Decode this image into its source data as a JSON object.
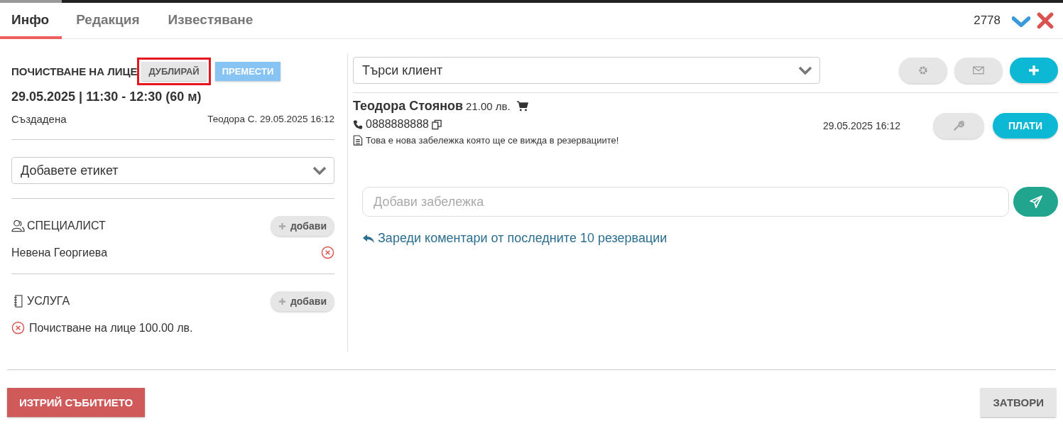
{
  "tabs": [
    {
      "label": "Инфо",
      "selected": true
    },
    {
      "label": "Редакция",
      "selected": false
    },
    {
      "label": "Известяване",
      "selected": false
    }
  ],
  "header": {
    "record_id": "2778"
  },
  "event": {
    "title": "ПОЧИСТВАНЕ НА ЛИЦЕ",
    "actions": [
      {
        "kind": "duplicate",
        "label": "ДУБЛИРАЙ",
        "highlighted": true
      },
      {
        "kind": "move",
        "label": "ПРЕМЕСТИ",
        "highlighted": false
      }
    ],
    "datetime": "29.05.2025 | 11:30 - 12:30 (60 м)",
    "status": "Създадена",
    "created_by": "Теодора С. 29.05.2025 16:12"
  },
  "tag_select": {
    "placeholder": "Добавете етикет"
  },
  "sections": [
    {
      "kind": "specialist",
      "heading": "СПЕЦИАЛИСТ",
      "add_label": "добави",
      "items": [
        "Невена Георгиева"
      ]
    },
    {
      "kind": "service",
      "heading": "УСЛУГА",
      "add_label": "добави",
      "items": [
        "Почистване на лице 100.00 лв."
      ]
    }
  ],
  "client_search": {
    "placeholder": "Търси клиент"
  },
  "client": {
    "name": "Теодора Стоянов",
    "amount": "21.00 лв.",
    "phone": "0888888888",
    "note": "Това е нова забележка която ще се вижда в резервациите!",
    "date": "29.05.2025 16:12",
    "pay_label": "ПЛАТИ"
  },
  "note_input": {
    "placeholder": "Добави забележка"
  },
  "load_comments": "Зареди коментари от последните 10 резервации",
  "footer": {
    "delete_label": "ИЗТРИЙ СЪБИТИЕТО",
    "close_label": "ЗАТВОРИ"
  }
}
